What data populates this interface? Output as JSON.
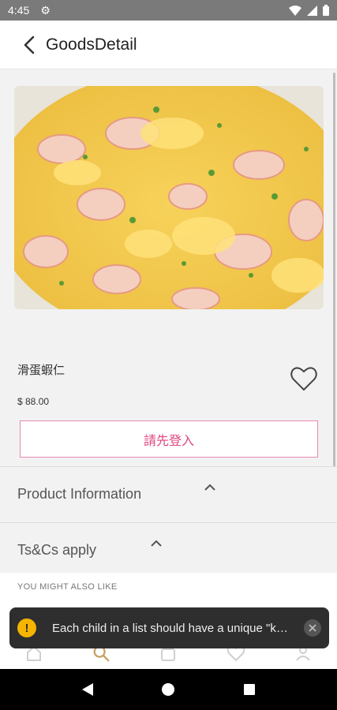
{
  "status_bar": {
    "time": "4:45"
  },
  "app_bar": {
    "title": "GoodsDetail"
  },
  "product": {
    "name": "滑蛋蝦仁",
    "price": "$ 88.00",
    "login_button": "請先登入"
  },
  "sections": [
    {
      "label": "Product Information"
    },
    {
      "label": "Ts&Cs apply"
    }
  ],
  "similar": {
    "label": "YOU MIGHT ALSO LIKE"
  },
  "toast": {
    "message": "Each child in a list should have a unique \"ke..."
  },
  "colors": {
    "accent": "#e0457f",
    "accent_border": "#e58ab4",
    "nav_active": "#c9a063",
    "toast_bg": "#2e2e2e",
    "warning": "#f5b400"
  },
  "icons": {
    "status": [
      "gear-icon",
      "wifi-icon",
      "signal-icon",
      "battery-icon"
    ],
    "bottom_nav": [
      "home-icon",
      "search-icon",
      "bag-icon",
      "heart-icon",
      "user-icon"
    ],
    "system_nav": [
      "back-icon",
      "home-icon",
      "recents-icon"
    ]
  }
}
